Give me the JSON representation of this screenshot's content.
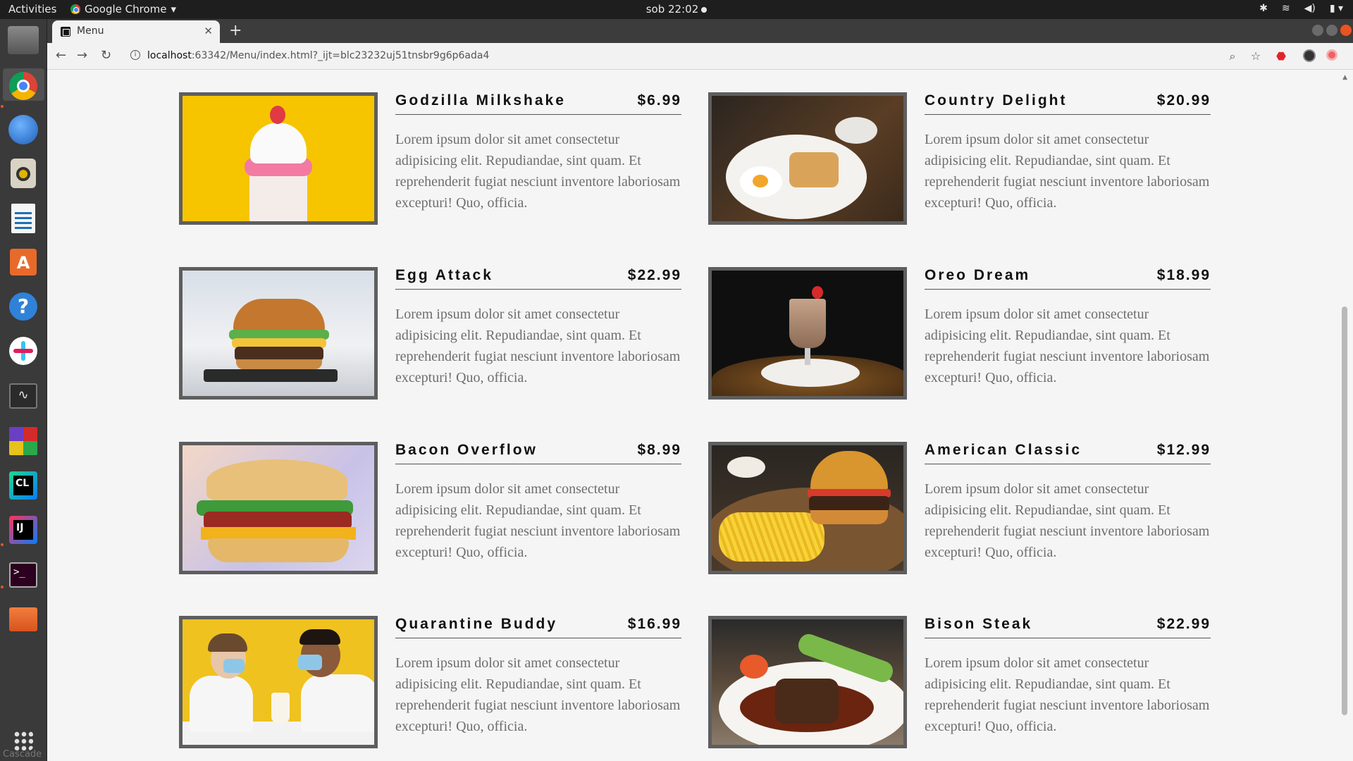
{
  "topbar": {
    "activities": "Activities",
    "app_name": "Google Chrome",
    "clock": "sob 22:02"
  },
  "dock": {
    "label": "Cascade"
  },
  "browser": {
    "tab_title": "Menu",
    "url_host": "localhost",
    "url_rest": ":63342/Menu/index.html?_ijt=blc23232uj51tnsbr9g6p6ada4"
  },
  "menu": {
    "items": [
      {
        "name": "Godzilla Milkshake",
        "price": "$6.99",
        "desc": "Lorem ipsum dolor sit amet consectetur adipisicing elit. Repudiandae, sint quam. Et reprehenderit fugiat nesciunt inventore laboriosam excepturi! Quo, officia."
      },
      {
        "name": "Country Delight",
        "price": "$20.99",
        "desc": "Lorem ipsum dolor sit amet consectetur adipisicing elit. Repudiandae, sint quam. Et reprehenderit fugiat nesciunt inventore laboriosam excepturi! Quo, officia."
      },
      {
        "name": "Egg Attack",
        "price": "$22.99",
        "desc": "Lorem ipsum dolor sit amet consectetur adipisicing elit. Repudiandae, sint quam. Et reprehenderit fugiat nesciunt inventore laboriosam excepturi! Quo, officia."
      },
      {
        "name": "Oreo Dream",
        "price": "$18.99",
        "desc": "Lorem ipsum dolor sit amet consectetur adipisicing elit. Repudiandae, sint quam. Et reprehenderit fugiat nesciunt inventore laboriosam excepturi! Quo, officia."
      },
      {
        "name": "Bacon Overflow",
        "price": "$8.99",
        "desc": "Lorem ipsum dolor sit amet consectetur adipisicing elit. Repudiandae, sint quam. Et reprehenderit fugiat nesciunt inventore laboriosam excepturi! Quo, officia."
      },
      {
        "name": "American Classic",
        "price": "$12.99",
        "desc": "Lorem ipsum dolor sit amet consectetur adipisicing elit. Repudiandae, sint quam. Et reprehenderit fugiat nesciunt inventore laboriosam excepturi! Quo, officia."
      },
      {
        "name": "Quarantine Buddy",
        "price": "$16.99",
        "desc": "Lorem ipsum dolor sit amet consectetur adipisicing elit. Repudiandae, sint quam. Et reprehenderit fugiat nesciunt inventore laboriosam excepturi! Quo, officia."
      },
      {
        "name": "Bison Steak",
        "price": "$22.99",
        "desc": "Lorem ipsum dolor sit amet consectetur adipisicing elit. Repudiandae, sint quam. Et reprehenderit fugiat nesciunt inventore laboriosam excepturi! Quo, officia."
      }
    ]
  },
  "colors": {
    "page_bg": "#f5f5f5",
    "photo_border": "#5e5e5e",
    "desc_text": "#6e6e6e",
    "ubuntu_accent": "#e95420"
  }
}
